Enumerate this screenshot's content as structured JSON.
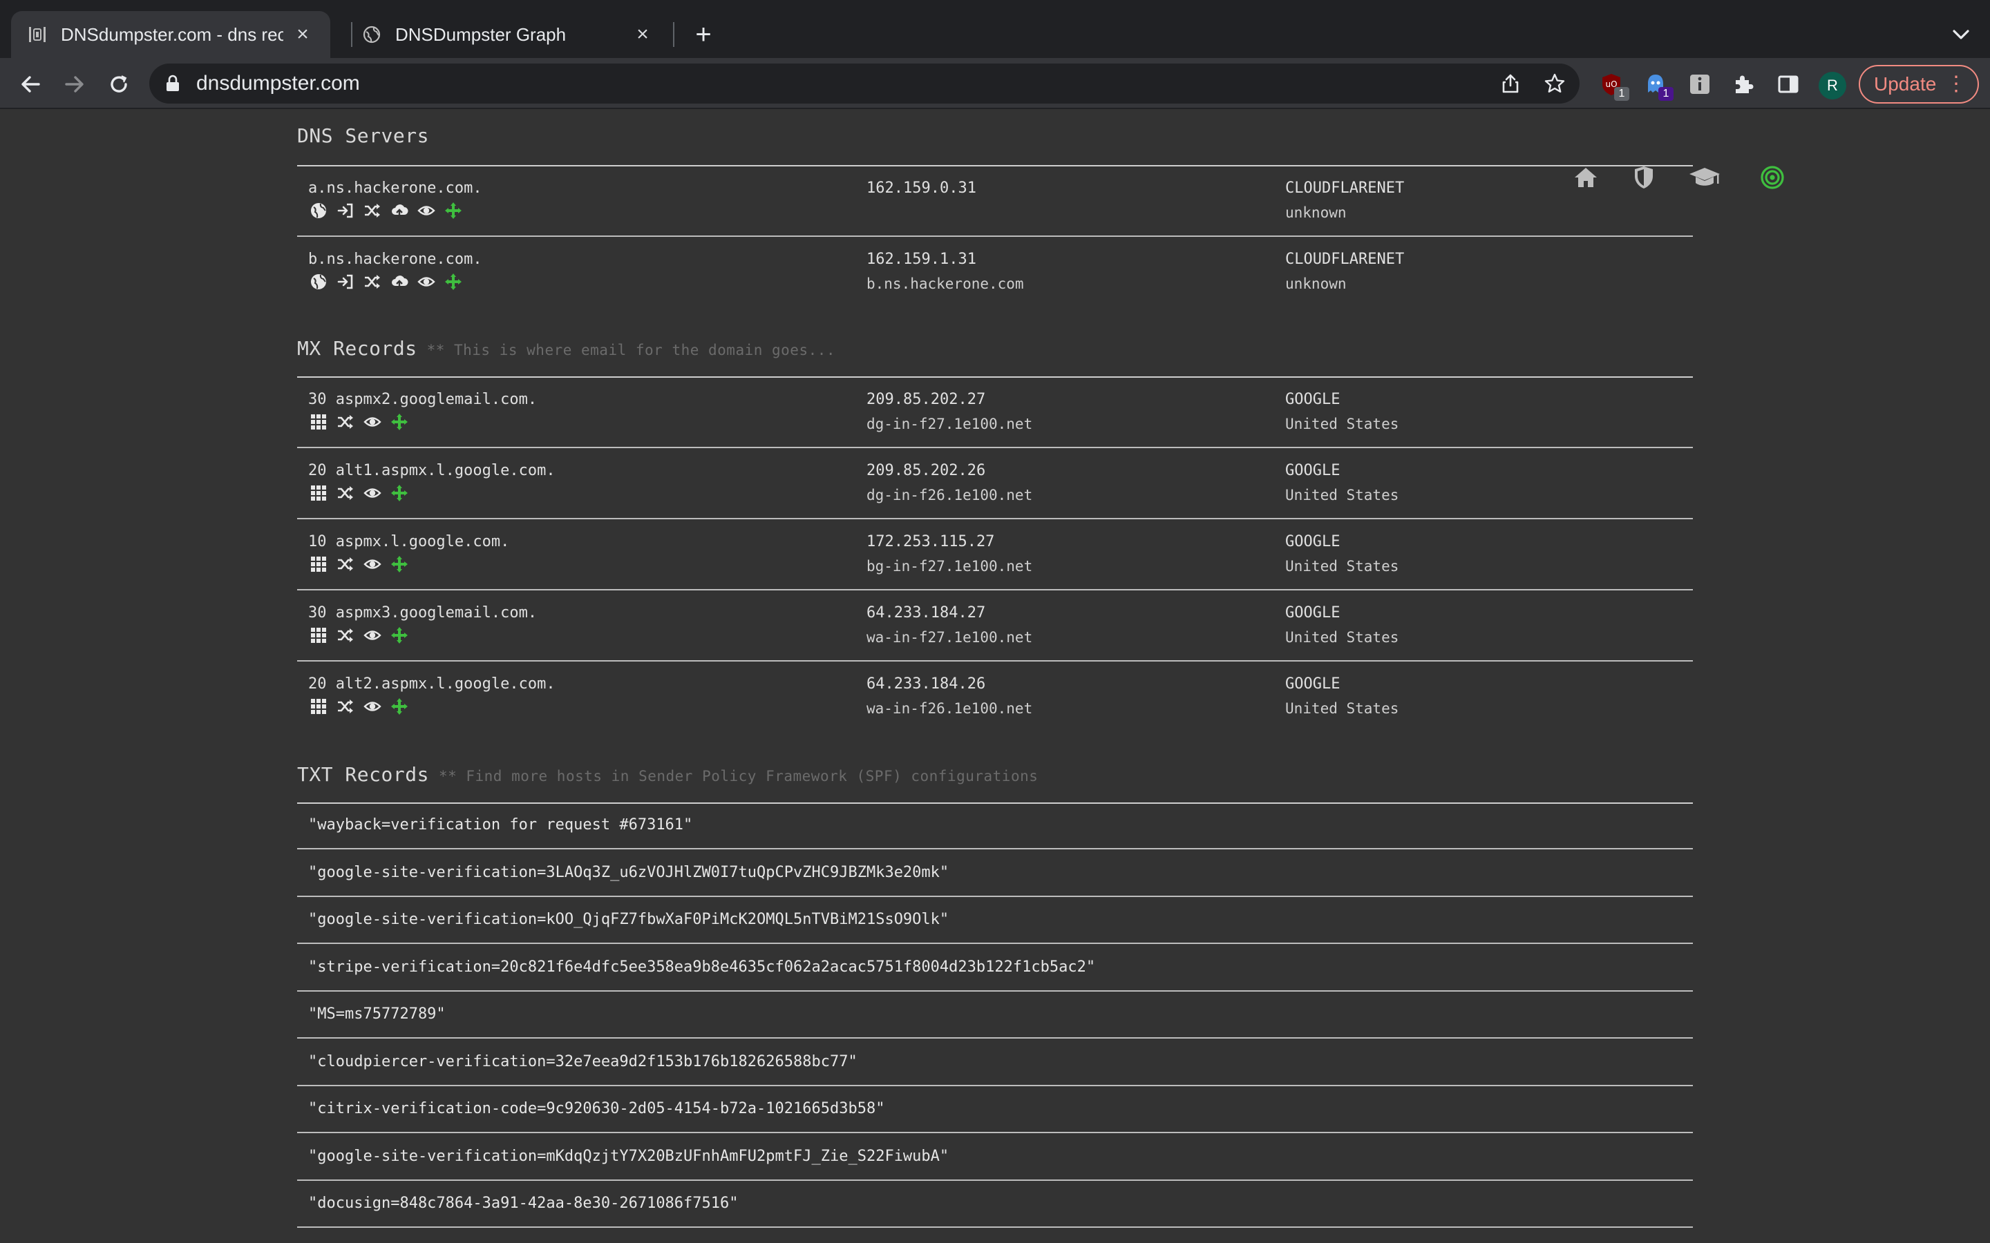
{
  "browser": {
    "tabs": [
      {
        "title": "DNSdumpster.com - dns recon",
        "active": true
      },
      {
        "title": "DNSDumpster Graph",
        "active": false
      }
    ],
    "url": "dnsdumpster.com",
    "update_label": "Update",
    "avatar_initial": "R",
    "extension_badges": [
      "1",
      "1"
    ]
  },
  "site_icons": [
    "home-icon",
    "shield-icon",
    "graduation-cap-icon",
    "target-icon"
  ],
  "dns_servers": {
    "heading": "DNS Servers",
    "rows": [
      {
        "host": "a.ns.hackerone.com.",
        "ip": "162.159.0.31",
        "reverse": "",
        "asn": "CLOUDFLARENET",
        "country": "unknown"
      },
      {
        "host": "b.ns.hackerone.com.",
        "ip": "162.159.1.31",
        "reverse": "b.ns.hackerone.com",
        "asn": "CLOUDFLARENET",
        "country": "unknown"
      }
    ]
  },
  "mx_records": {
    "heading": "MX Records",
    "subheading": "** This is where email for the domain goes...",
    "rows": [
      {
        "host": "30 aspmx2.googlemail.com.",
        "ip": "209.85.202.27",
        "reverse": "dg-in-f27.1e100.net",
        "asn": "GOOGLE",
        "country": "United States"
      },
      {
        "host": "20 alt1.aspmx.l.google.com.",
        "ip": "209.85.202.26",
        "reverse": "dg-in-f26.1e100.net",
        "asn": "GOOGLE",
        "country": "United States"
      },
      {
        "host": "10 aspmx.l.google.com.",
        "ip": "172.253.115.27",
        "reverse": "bg-in-f27.1e100.net",
        "asn": "GOOGLE",
        "country": "United States"
      },
      {
        "host": "30 aspmx3.googlemail.com.",
        "ip": "64.233.184.27",
        "reverse": "wa-in-f27.1e100.net",
        "asn": "GOOGLE",
        "country": "United States"
      },
      {
        "host": "20 alt2.aspmx.l.google.com.",
        "ip": "64.233.184.26",
        "reverse": "wa-in-f26.1e100.net",
        "asn": "GOOGLE",
        "country": "United States"
      }
    ]
  },
  "txt_records": {
    "heading": "TXT Records",
    "subheading": "** Find more hosts in Sender Policy Framework (SPF) configurations",
    "rows": [
      "\"wayback=verification for request #673161\"",
      "\"google-site-verification=3LAOq3Z_u6zVOJHlZW0I7tuQpCPvZHC9JBZMk3e20mk\"",
      "\"google-site-verification=kOO_QjqFZ7fbwXaF0PiMcK2OMQL5nTVBiM21SsO9Olk\"",
      "\"stripe-verification=20c821f6e4dfc5ee358ea9b8e4635cf062a2acac5751f8004d23b122f1cb5ac2\"",
      "\"MS=ms75772789\"",
      "\"cloudpiercer-verification=32e7eea9d2f153b176b182626588bc77\"",
      "\"citrix-verification-code=9c920630-2d05-4154-b72a-1021665d3b58\"",
      "\"google-site-verification=mKdqQzjtY7X20BzUFnhAmFU2pmtFJ_Zie_S22FiwubA\"",
      "\"docusign=848c7864-3a91-42aa-8e30-2671086f7516\""
    ]
  },
  "colors": {
    "accent_green": "#3fbf3f",
    "page_bg": "#333333",
    "chrome_bg": "#202124"
  }
}
